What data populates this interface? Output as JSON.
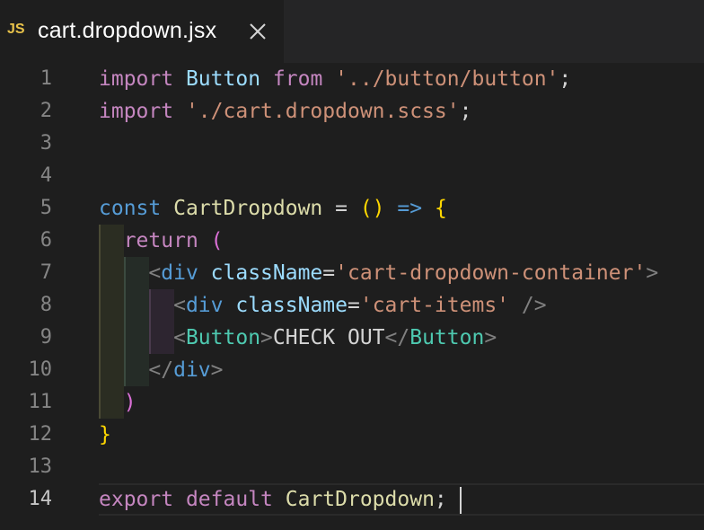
{
  "tab": {
    "icon_label": "JS",
    "title": "cart.dropdown.jsx",
    "close_icon": "close-icon"
  },
  "editor": {
    "line_numbers": [
      "1",
      "2",
      "3",
      "4",
      "5",
      "6",
      "7",
      "8",
      "9",
      "10",
      "11",
      "12",
      "13",
      "14"
    ],
    "active_line": 14,
    "lines": [
      [
        {
          "t": "import",
          "c": "kw"
        },
        {
          "t": " "
        },
        {
          "t": "Button",
          "c": "ident"
        },
        {
          "t": " "
        },
        {
          "t": "from",
          "c": "kw"
        },
        {
          "t": " "
        },
        {
          "t": "'../button/button'",
          "c": "str"
        },
        {
          "t": ";"
        }
      ],
      [
        {
          "t": "import",
          "c": "kw"
        },
        {
          "t": " "
        },
        {
          "t": "'./cart.dropdown.scss'",
          "c": "str"
        },
        {
          "t": ";"
        }
      ],
      [],
      [],
      [
        {
          "t": "const",
          "c": "decl"
        },
        {
          "t": " "
        },
        {
          "t": "CartDropdown",
          "c": "fn"
        },
        {
          "t": " = "
        },
        {
          "t": "()",
          "c": "br1"
        },
        {
          "t": " "
        },
        {
          "t": "=>",
          "c": "decl"
        },
        {
          "t": " "
        },
        {
          "t": "{",
          "c": "br1"
        }
      ],
      [
        {
          "t": "  "
        },
        {
          "t": "return",
          "c": "kw"
        },
        {
          "t": " "
        },
        {
          "t": "(",
          "c": "br2"
        }
      ],
      [
        {
          "t": "    "
        },
        {
          "t": "<",
          "c": "punc"
        },
        {
          "t": "div",
          "c": "tag"
        },
        {
          "t": " "
        },
        {
          "t": "className",
          "c": "attr"
        },
        {
          "t": "="
        },
        {
          "t": "'cart-dropdown-container'",
          "c": "str"
        },
        {
          "t": ">",
          "c": "punc"
        }
      ],
      [
        {
          "t": "      "
        },
        {
          "t": "<",
          "c": "punc"
        },
        {
          "t": "div",
          "c": "tag"
        },
        {
          "t": " "
        },
        {
          "t": "className",
          "c": "attr"
        },
        {
          "t": "="
        },
        {
          "t": "'cart-items'",
          "c": "str"
        },
        {
          "t": " "
        },
        {
          "t": "/>",
          "c": "punc"
        }
      ],
      [
        {
          "t": "      "
        },
        {
          "t": "<",
          "c": "punc"
        },
        {
          "t": "Button",
          "c": "cmp"
        },
        {
          "t": ">",
          "c": "punc"
        },
        {
          "t": "CHECK OUT",
          "c": "txt"
        },
        {
          "t": "</",
          "c": "punc"
        },
        {
          "t": "Button",
          "c": "cmp"
        },
        {
          "t": ">",
          "c": "punc"
        }
      ],
      [
        {
          "t": "    "
        },
        {
          "t": "</",
          "c": "punc"
        },
        {
          "t": "div",
          "c": "tag"
        },
        {
          "t": ">",
          "c": "punc"
        }
      ],
      [
        {
          "t": "  "
        },
        {
          "t": ")",
          "c": "br2"
        }
      ],
      [
        {
          "t": "}",
          "c": "br1"
        }
      ],
      [],
      [
        {
          "t": "export",
          "c": "kw"
        },
        {
          "t": " "
        },
        {
          "t": "default",
          "c": "kw"
        },
        {
          "t": " "
        },
        {
          "t": "CartDropdown",
          "c": "fn"
        },
        {
          "t": ";"
        }
      ]
    ]
  },
  "colors": {
    "editor_bg": "#1e1e1e",
    "tabbar_bg": "#252526",
    "js_badge": "#e8c24a",
    "keyword": "#c586c0",
    "declaration": "#569cd6",
    "string": "#ce9178",
    "function": "#dcdcaa",
    "component": "#4ec9b0"
  }
}
